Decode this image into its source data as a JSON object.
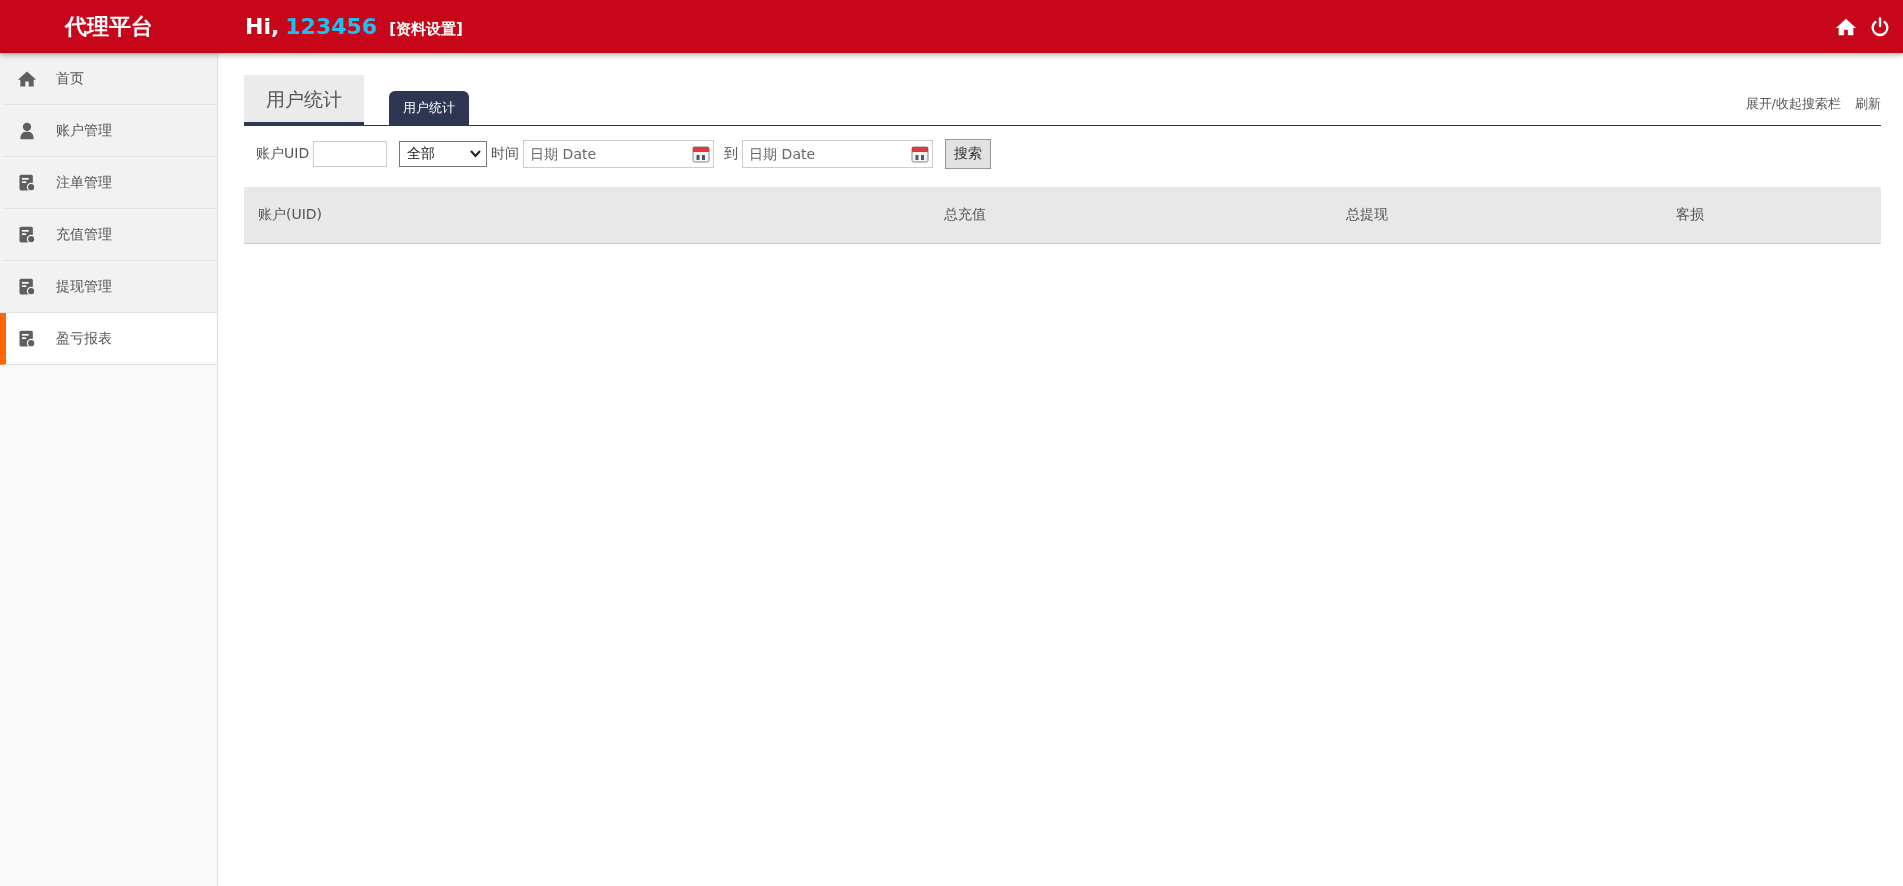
{
  "header": {
    "title": "代理平台",
    "greeting": "Hi,",
    "username": "123456",
    "settings_link": "[资料设置]"
  },
  "sidebar": {
    "items": [
      {
        "label": "首页",
        "kind": "home",
        "selected": false
      },
      {
        "label": "账户管理",
        "kind": "user",
        "selected": false
      },
      {
        "label": "注单管理",
        "kind": "report",
        "selected": false
      },
      {
        "label": "充值管理",
        "kind": "report",
        "selected": false
      },
      {
        "label": "提现管理",
        "kind": "report",
        "selected": false
      },
      {
        "label": "盈亏报表",
        "kind": "report",
        "selected": true
      }
    ]
  },
  "page_title": "用户统计",
  "tabs": [
    {
      "label": "用户统计",
      "selected": true
    }
  ],
  "actions": [
    "展开/收起搜索栏",
    "刷新"
  ],
  "search": {
    "uid_label": "账户UID",
    "select_value": "全部",
    "time_label": "时间",
    "from_placeholder": "日期 Date",
    "to_label": "到",
    "to_placeholder": "日期 Date",
    "button": "搜索"
  },
  "table": {
    "columns": [
      "账户(UID)",
      "总充值",
      "总提现",
      "客损"
    ]
  }
}
